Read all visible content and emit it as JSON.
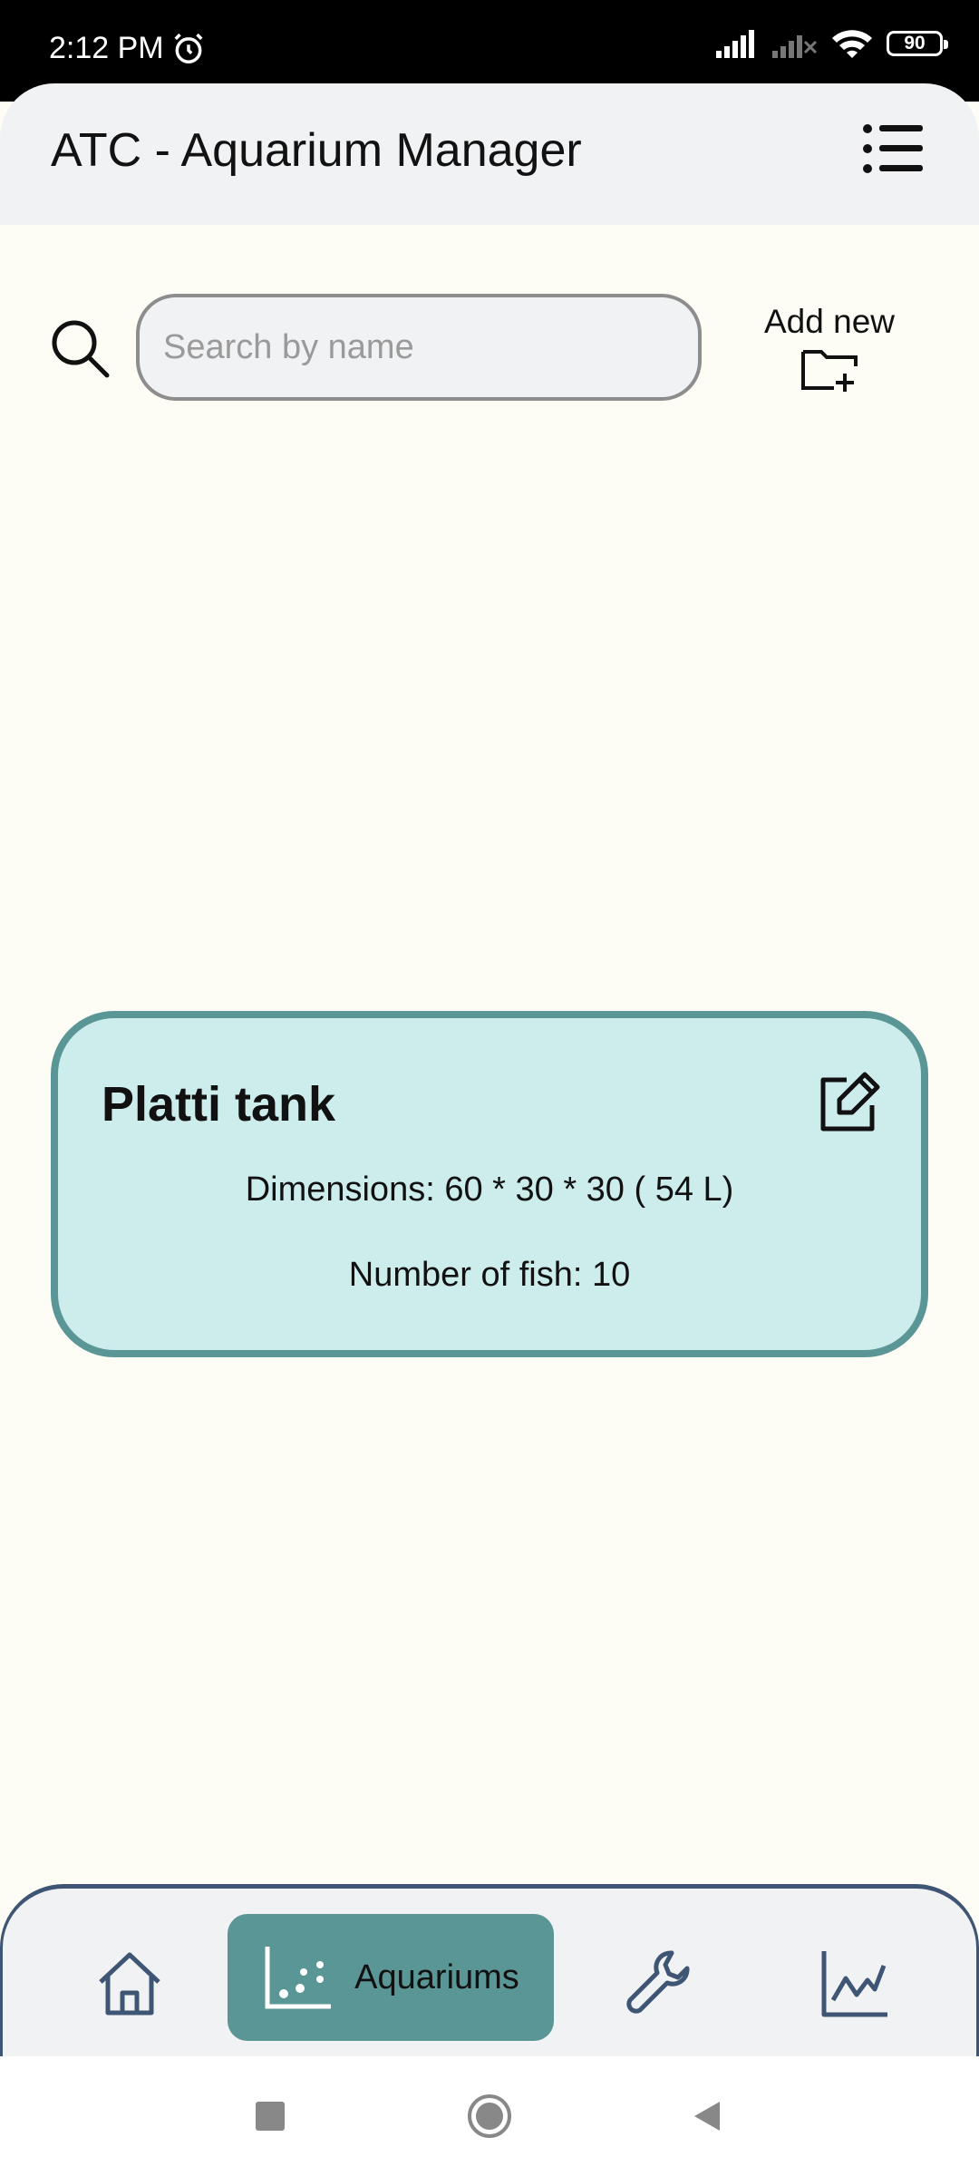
{
  "status_bar": {
    "time": "2:12 PM",
    "battery": "90"
  },
  "app_bar": {
    "title": "ATC - Aquarium Manager"
  },
  "search": {
    "placeholder": "Search by name",
    "value": ""
  },
  "add_new": {
    "label": "Add new"
  },
  "tanks": [
    {
      "name": "Platti tank",
      "dimensions": "Dimensions: 60 * 30 * 30 ( 54 L)",
      "fish": "Number of fish: 10"
    }
  ],
  "bottom_nav": {
    "active_label": "Aquariums",
    "active_color": "#5a9696",
    "icon_color": "#3f5574"
  }
}
